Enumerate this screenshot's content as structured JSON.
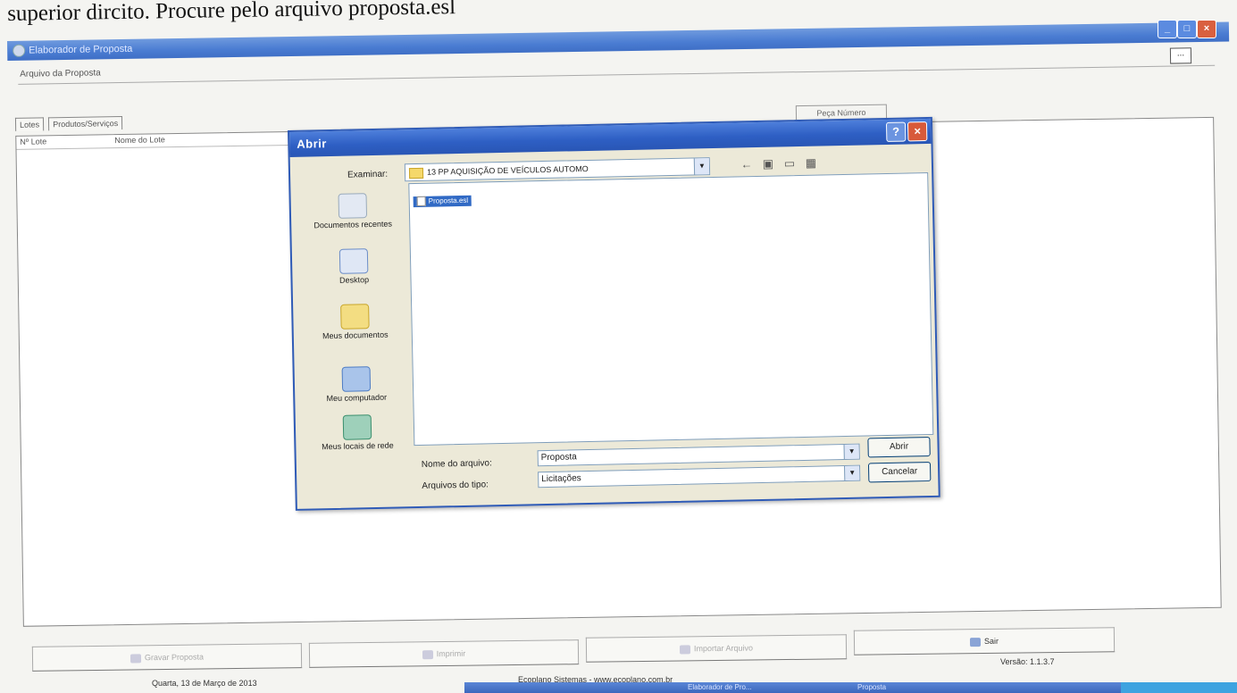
{
  "caption": "superior dircito. Procure pelo arquivo proposta.esl",
  "app": {
    "title": "Elaborador de Proposta",
    "arquivo_label": "Arquivo da Proposta",
    "browse_label": "...",
    "tabs": [
      "Lotes",
      "Produtos/Serviços"
    ],
    "peca_button": "Peça Número",
    "columns": [
      "Nº Lote",
      "Nome do Lote"
    ]
  },
  "dialog": {
    "title": "Abrir",
    "examinar_label": "Examinar:",
    "folder": "13 PP AQUISIÇÃO DE VEÍCULOS AUTOMO",
    "places": [
      "Documentos recentes",
      "Desktop",
      "Meus documentos",
      "Meu computador",
      "Meus locais de rede"
    ],
    "file": "Proposta.esl",
    "nome_label": "Nome do arquivo:",
    "nome_value": "Proposta",
    "tipo_label": "Arquivos do tipo:",
    "tipo_value": "Licitações",
    "abrir_button": "Abrir",
    "cancelar_button": "Cancelar"
  },
  "footer": {
    "buttons": [
      "Gravar Proposta",
      "Imprimir",
      "Importar Arquivo",
      "Sair"
    ],
    "status_date": "Quarta, 13 de Março de 2013",
    "site": "Ecoplano Sistemas - www.ecoplano.com.br",
    "versao": "Versão: 1.1.3.7",
    "taskbar_items": [
      "Elaborador de Pro...",
      "Proposta"
    ]
  },
  "colors": {
    "xp_blue": "#2e5fc4",
    "selection": "#316ac5"
  }
}
